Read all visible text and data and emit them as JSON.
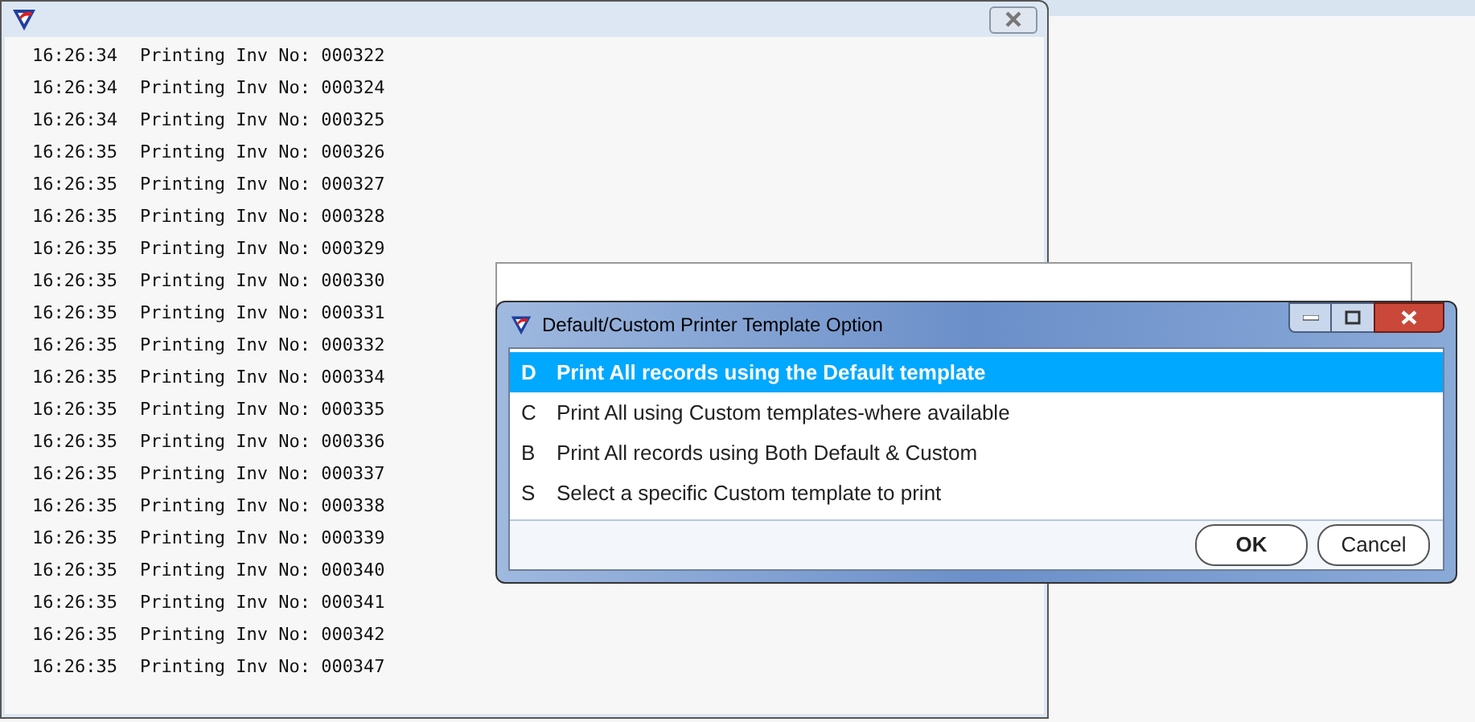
{
  "log_window": {
    "lines": [
      {
        "time": "16:26:34",
        "message": "Printing Inv No: 000322"
      },
      {
        "time": "16:26:34",
        "message": "Printing Inv No: 000324"
      },
      {
        "time": "16:26:34",
        "message": "Printing Inv No: 000325"
      },
      {
        "time": "16:26:35",
        "message": "Printing Inv No: 000326"
      },
      {
        "time": "16:26:35",
        "message": "Printing Inv No: 000327"
      },
      {
        "time": "16:26:35",
        "message": "Printing Inv No: 000328"
      },
      {
        "time": "16:26:35",
        "message": "Printing Inv No: 000329"
      },
      {
        "time": "16:26:35",
        "message": "Printing Inv No: 000330"
      },
      {
        "time": "16:26:35",
        "message": "Printing Inv No: 000331"
      },
      {
        "time": "16:26:35",
        "message": "Printing Inv No: 000332"
      },
      {
        "time": "16:26:35",
        "message": "Printing Inv No: 000334"
      },
      {
        "time": "16:26:35",
        "message": "Printing Inv No: 000335"
      },
      {
        "time": "16:26:35",
        "message": "Printing Inv No: 000336"
      },
      {
        "time": "16:26:35",
        "message": "Printing Inv No: 000337"
      },
      {
        "time": "16:26:35",
        "message": "Printing Inv No: 000338"
      },
      {
        "time": "16:26:35",
        "message": "Printing Inv No: 000339"
      },
      {
        "time": "16:26:35",
        "message": "Printing Inv No: 000340"
      },
      {
        "time": "16:26:35",
        "message": "Printing Inv No: 000341"
      },
      {
        "time": "16:26:35",
        "message": "Printing Inv No: 000342"
      },
      {
        "time": "16:26:35",
        "message": "Printing Inv No: 000347"
      }
    ]
  },
  "dialog": {
    "title": "Default/Custom Printer Template Option",
    "options": [
      {
        "key": "D",
        "label": "Print All records using the Default template",
        "selected": true
      },
      {
        "key": "C",
        "label": "Print All using Custom templates-where available",
        "selected": false
      },
      {
        "key": "B",
        "label": "Print All records using Both Default & Custom",
        "selected": false
      },
      {
        "key": "S",
        "label": "Select a specific Custom template to print",
        "selected": false
      }
    ],
    "buttons": [
      {
        "label": "OK",
        "kind": "default"
      },
      {
        "label": "Cancel",
        "kind": "normal"
      }
    ]
  }
}
